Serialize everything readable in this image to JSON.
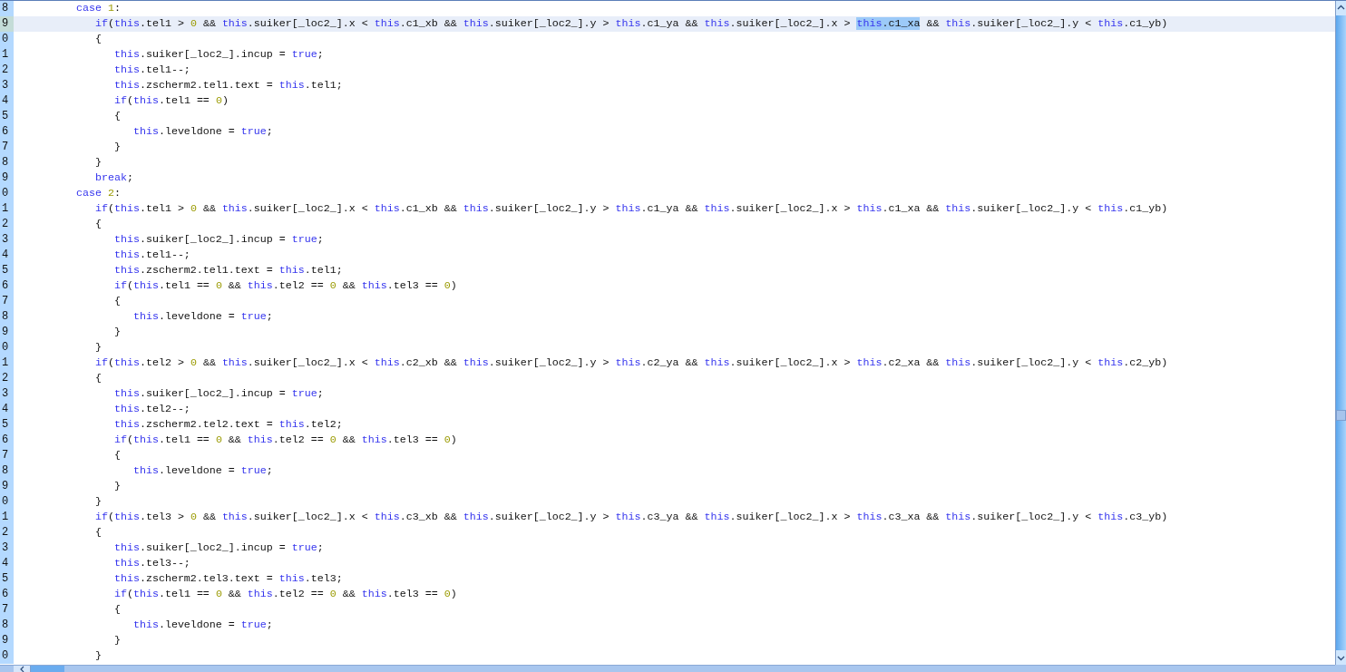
{
  "editor": {
    "lines": [
      {
        "number": "8",
        "current": false,
        "segments": [
          {
            "kind": "keyword",
            "text": "         case "
          },
          {
            "kind": "number",
            "text": "1"
          },
          {
            "kind": "plain",
            "text": ":"
          }
        ]
      },
      {
        "number": "9",
        "current": true,
        "segments": [
          {
            "kind": "keyword",
            "text": "            if"
          },
          {
            "kind": "plain",
            "text": "("
          },
          {
            "kind": "keyword",
            "text": "this"
          },
          {
            "kind": "plain",
            "text": ".tel1 > "
          },
          {
            "kind": "number",
            "text": "0"
          },
          {
            "kind": "plain",
            "text": " && "
          },
          {
            "kind": "keyword",
            "text": "this"
          },
          {
            "kind": "plain",
            "text": ".suiker[_loc2_].x < "
          },
          {
            "kind": "keyword",
            "text": "this"
          },
          {
            "kind": "plain",
            "text": ".c1_xb && "
          },
          {
            "kind": "keyword",
            "text": "this"
          },
          {
            "kind": "plain",
            "text": ".suiker[_loc2_].y > "
          },
          {
            "kind": "keyword",
            "text": "this"
          },
          {
            "kind": "plain",
            "text": ".c1_ya && "
          },
          {
            "kind": "keyword",
            "text": "this"
          },
          {
            "kind": "plain",
            "text": ".suiker[_loc2_].x > "
          },
          {
            "kind": "keyword",
            "text": "this",
            "highlighted": true
          },
          {
            "kind": "plain",
            "text": ".c1_xa",
            "highlighted": true
          },
          {
            "kind": "plain",
            "text": " && "
          },
          {
            "kind": "keyword",
            "text": "this"
          },
          {
            "kind": "plain",
            "text": ".suiker[_loc2_].y < "
          },
          {
            "kind": "keyword",
            "text": "this"
          },
          {
            "kind": "plain",
            "text": ".c1_yb)"
          }
        ]
      },
      {
        "number": "0",
        "current": false,
        "segments": [
          {
            "kind": "plain",
            "text": "            {"
          }
        ]
      },
      {
        "number": "1",
        "current": false,
        "segments": [
          {
            "kind": "keyword",
            "text": "               this"
          },
          {
            "kind": "plain",
            "text": ".suiker[_loc2_].incup = "
          },
          {
            "kind": "keyword",
            "text": "true"
          },
          {
            "kind": "plain",
            "text": ";"
          }
        ]
      },
      {
        "number": "2",
        "current": false,
        "segments": [
          {
            "kind": "keyword",
            "text": "               this"
          },
          {
            "kind": "plain",
            "text": ".tel1--;"
          }
        ]
      },
      {
        "number": "3",
        "current": false,
        "segments": [
          {
            "kind": "keyword",
            "text": "               this"
          },
          {
            "kind": "plain",
            "text": ".zscherm2.tel1.text = "
          },
          {
            "kind": "keyword",
            "text": "this"
          },
          {
            "kind": "plain",
            "text": ".tel1;"
          }
        ]
      },
      {
        "number": "4",
        "current": false,
        "segments": [
          {
            "kind": "keyword",
            "text": "               if"
          },
          {
            "kind": "plain",
            "text": "("
          },
          {
            "kind": "keyword",
            "text": "this"
          },
          {
            "kind": "plain",
            "text": ".tel1 == "
          },
          {
            "kind": "number",
            "text": "0"
          },
          {
            "kind": "plain",
            "text": ")"
          }
        ]
      },
      {
        "number": "5",
        "current": false,
        "segments": [
          {
            "kind": "plain",
            "text": "               {"
          }
        ]
      },
      {
        "number": "6",
        "current": false,
        "segments": [
          {
            "kind": "keyword",
            "text": "                  this"
          },
          {
            "kind": "plain",
            "text": ".leveldone = "
          },
          {
            "kind": "keyword",
            "text": "true"
          },
          {
            "kind": "plain",
            "text": ";"
          }
        ]
      },
      {
        "number": "7",
        "current": false,
        "segments": [
          {
            "kind": "plain",
            "text": "               }"
          }
        ]
      },
      {
        "number": "8",
        "current": false,
        "segments": [
          {
            "kind": "plain",
            "text": "            }"
          }
        ]
      },
      {
        "number": "9",
        "current": false,
        "segments": [
          {
            "kind": "keyword",
            "text": "            break"
          },
          {
            "kind": "plain",
            "text": ";"
          }
        ]
      },
      {
        "number": "0",
        "current": false,
        "segments": [
          {
            "kind": "keyword",
            "text": "         case "
          },
          {
            "kind": "number",
            "text": "2"
          },
          {
            "kind": "plain",
            "text": ":"
          }
        ]
      },
      {
        "number": "1",
        "current": false,
        "segments": [
          {
            "kind": "keyword",
            "text": "            if"
          },
          {
            "kind": "plain",
            "text": "("
          },
          {
            "kind": "keyword",
            "text": "this"
          },
          {
            "kind": "plain",
            "text": ".tel1 > "
          },
          {
            "kind": "number",
            "text": "0"
          },
          {
            "kind": "plain",
            "text": " && "
          },
          {
            "kind": "keyword",
            "text": "this"
          },
          {
            "kind": "plain",
            "text": ".suiker[_loc2_].x < "
          },
          {
            "kind": "keyword",
            "text": "this"
          },
          {
            "kind": "plain",
            "text": ".c1_xb && "
          },
          {
            "kind": "keyword",
            "text": "this"
          },
          {
            "kind": "plain",
            "text": ".suiker[_loc2_].y > "
          },
          {
            "kind": "keyword",
            "text": "this"
          },
          {
            "kind": "plain",
            "text": ".c1_ya && "
          },
          {
            "kind": "keyword",
            "text": "this"
          },
          {
            "kind": "plain",
            "text": ".suiker[_loc2_].x > "
          },
          {
            "kind": "keyword",
            "text": "this"
          },
          {
            "kind": "plain",
            "text": ".c1_xa && "
          },
          {
            "kind": "keyword",
            "text": "this"
          },
          {
            "kind": "plain",
            "text": ".suiker[_loc2_].y < "
          },
          {
            "kind": "keyword",
            "text": "this"
          },
          {
            "kind": "plain",
            "text": ".c1_yb)"
          }
        ]
      },
      {
        "number": "2",
        "current": false,
        "segments": [
          {
            "kind": "plain",
            "text": "            {"
          }
        ]
      },
      {
        "number": "3",
        "current": false,
        "segments": [
          {
            "kind": "keyword",
            "text": "               this"
          },
          {
            "kind": "plain",
            "text": ".suiker[_loc2_].incup = "
          },
          {
            "kind": "keyword",
            "text": "true"
          },
          {
            "kind": "plain",
            "text": ";"
          }
        ]
      },
      {
        "number": "4",
        "current": false,
        "segments": [
          {
            "kind": "keyword",
            "text": "               this"
          },
          {
            "kind": "plain",
            "text": ".tel1--;"
          }
        ]
      },
      {
        "number": "5",
        "current": false,
        "segments": [
          {
            "kind": "keyword",
            "text": "               this"
          },
          {
            "kind": "plain",
            "text": ".zscherm2.tel1.text = "
          },
          {
            "kind": "keyword",
            "text": "this"
          },
          {
            "kind": "plain",
            "text": ".tel1;"
          }
        ]
      },
      {
        "number": "6",
        "current": false,
        "segments": [
          {
            "kind": "keyword",
            "text": "               if"
          },
          {
            "kind": "plain",
            "text": "("
          },
          {
            "kind": "keyword",
            "text": "this"
          },
          {
            "kind": "plain",
            "text": ".tel1 == "
          },
          {
            "kind": "number",
            "text": "0"
          },
          {
            "kind": "plain",
            "text": " && "
          },
          {
            "kind": "keyword",
            "text": "this"
          },
          {
            "kind": "plain",
            "text": ".tel2 == "
          },
          {
            "kind": "number",
            "text": "0"
          },
          {
            "kind": "plain",
            "text": " && "
          },
          {
            "kind": "keyword",
            "text": "this"
          },
          {
            "kind": "plain",
            "text": ".tel3 == "
          },
          {
            "kind": "number",
            "text": "0"
          },
          {
            "kind": "plain",
            "text": ")"
          }
        ]
      },
      {
        "number": "7",
        "current": false,
        "segments": [
          {
            "kind": "plain",
            "text": "               {"
          }
        ]
      },
      {
        "number": "8",
        "current": false,
        "segments": [
          {
            "kind": "keyword",
            "text": "                  this"
          },
          {
            "kind": "plain",
            "text": ".leveldone = "
          },
          {
            "kind": "keyword",
            "text": "true"
          },
          {
            "kind": "plain",
            "text": ";"
          }
        ]
      },
      {
        "number": "9",
        "current": false,
        "segments": [
          {
            "kind": "plain",
            "text": "               }"
          }
        ]
      },
      {
        "number": "0",
        "current": false,
        "segments": [
          {
            "kind": "plain",
            "text": "            }"
          }
        ]
      },
      {
        "number": "1",
        "current": false,
        "segments": [
          {
            "kind": "keyword",
            "text": "            if"
          },
          {
            "kind": "plain",
            "text": "("
          },
          {
            "kind": "keyword",
            "text": "this"
          },
          {
            "kind": "plain",
            "text": ".tel2 > "
          },
          {
            "kind": "number",
            "text": "0"
          },
          {
            "kind": "plain",
            "text": " && "
          },
          {
            "kind": "keyword",
            "text": "this"
          },
          {
            "kind": "plain",
            "text": ".suiker[_loc2_].x < "
          },
          {
            "kind": "keyword",
            "text": "this"
          },
          {
            "kind": "plain",
            "text": ".c2_xb && "
          },
          {
            "kind": "keyword",
            "text": "this"
          },
          {
            "kind": "plain",
            "text": ".suiker[_loc2_].y > "
          },
          {
            "kind": "keyword",
            "text": "this"
          },
          {
            "kind": "plain",
            "text": ".c2_ya && "
          },
          {
            "kind": "keyword",
            "text": "this"
          },
          {
            "kind": "plain",
            "text": ".suiker[_loc2_].x > "
          },
          {
            "kind": "keyword",
            "text": "this"
          },
          {
            "kind": "plain",
            "text": ".c2_xa && "
          },
          {
            "kind": "keyword",
            "text": "this"
          },
          {
            "kind": "plain",
            "text": ".suiker[_loc2_].y < "
          },
          {
            "kind": "keyword",
            "text": "this"
          },
          {
            "kind": "plain",
            "text": ".c2_yb)"
          }
        ]
      },
      {
        "number": "2",
        "current": false,
        "segments": [
          {
            "kind": "plain",
            "text": "            {"
          }
        ]
      },
      {
        "number": "3",
        "current": false,
        "segments": [
          {
            "kind": "keyword",
            "text": "               this"
          },
          {
            "kind": "plain",
            "text": ".suiker[_loc2_].incup = "
          },
          {
            "kind": "keyword",
            "text": "true"
          },
          {
            "kind": "plain",
            "text": ";"
          }
        ]
      },
      {
        "number": "4",
        "current": false,
        "segments": [
          {
            "kind": "keyword",
            "text": "               this"
          },
          {
            "kind": "plain",
            "text": ".tel2--;"
          }
        ]
      },
      {
        "number": "5",
        "current": false,
        "segments": [
          {
            "kind": "keyword",
            "text": "               this"
          },
          {
            "kind": "plain",
            "text": ".zscherm2.tel2.text = "
          },
          {
            "kind": "keyword",
            "text": "this"
          },
          {
            "kind": "plain",
            "text": ".tel2;"
          }
        ]
      },
      {
        "number": "6",
        "current": false,
        "segments": [
          {
            "kind": "keyword",
            "text": "               if"
          },
          {
            "kind": "plain",
            "text": "("
          },
          {
            "kind": "keyword",
            "text": "this"
          },
          {
            "kind": "plain",
            "text": ".tel1 == "
          },
          {
            "kind": "number",
            "text": "0"
          },
          {
            "kind": "plain",
            "text": " && "
          },
          {
            "kind": "keyword",
            "text": "this"
          },
          {
            "kind": "plain",
            "text": ".tel2 == "
          },
          {
            "kind": "number",
            "text": "0"
          },
          {
            "kind": "plain",
            "text": " && "
          },
          {
            "kind": "keyword",
            "text": "this"
          },
          {
            "kind": "plain",
            "text": ".tel3 == "
          },
          {
            "kind": "number",
            "text": "0"
          },
          {
            "kind": "plain",
            "text": ")"
          }
        ]
      },
      {
        "number": "7",
        "current": false,
        "segments": [
          {
            "kind": "plain",
            "text": "               {"
          }
        ]
      },
      {
        "number": "8",
        "current": false,
        "segments": [
          {
            "kind": "keyword",
            "text": "                  this"
          },
          {
            "kind": "plain",
            "text": ".leveldone = "
          },
          {
            "kind": "keyword",
            "text": "true"
          },
          {
            "kind": "plain",
            "text": ";"
          }
        ]
      },
      {
        "number": "9",
        "current": false,
        "segments": [
          {
            "kind": "plain",
            "text": "               }"
          }
        ]
      },
      {
        "number": "0",
        "current": false,
        "segments": [
          {
            "kind": "plain",
            "text": "            }"
          }
        ]
      },
      {
        "number": "1",
        "current": false,
        "segments": [
          {
            "kind": "keyword",
            "text": "            if"
          },
          {
            "kind": "plain",
            "text": "("
          },
          {
            "kind": "keyword",
            "text": "this"
          },
          {
            "kind": "plain",
            "text": ".tel3 > "
          },
          {
            "kind": "number",
            "text": "0"
          },
          {
            "kind": "plain",
            "text": " && "
          },
          {
            "kind": "keyword",
            "text": "this"
          },
          {
            "kind": "plain",
            "text": ".suiker[_loc2_].x < "
          },
          {
            "kind": "keyword",
            "text": "this"
          },
          {
            "kind": "plain",
            "text": ".c3_xb && "
          },
          {
            "kind": "keyword",
            "text": "this"
          },
          {
            "kind": "plain",
            "text": ".suiker[_loc2_].y > "
          },
          {
            "kind": "keyword",
            "text": "this"
          },
          {
            "kind": "plain",
            "text": ".c3_ya && "
          },
          {
            "kind": "keyword",
            "text": "this"
          },
          {
            "kind": "plain",
            "text": ".suiker[_loc2_].x > "
          },
          {
            "kind": "keyword",
            "text": "this"
          },
          {
            "kind": "plain",
            "text": ".c3_xa && "
          },
          {
            "kind": "keyword",
            "text": "this"
          },
          {
            "kind": "plain",
            "text": ".suiker[_loc2_].y < "
          },
          {
            "kind": "keyword",
            "text": "this"
          },
          {
            "kind": "plain",
            "text": ".c3_yb)"
          }
        ]
      },
      {
        "number": "2",
        "current": false,
        "segments": [
          {
            "kind": "plain",
            "text": "            {"
          }
        ]
      },
      {
        "number": "3",
        "current": false,
        "segments": [
          {
            "kind": "keyword",
            "text": "               this"
          },
          {
            "kind": "plain",
            "text": ".suiker[_loc2_].incup = "
          },
          {
            "kind": "keyword",
            "text": "true"
          },
          {
            "kind": "plain",
            "text": ";"
          }
        ]
      },
      {
        "number": "4",
        "current": false,
        "segments": [
          {
            "kind": "keyword",
            "text": "               this"
          },
          {
            "kind": "plain",
            "text": ".tel3--;"
          }
        ]
      },
      {
        "number": "5",
        "current": false,
        "segments": [
          {
            "kind": "keyword",
            "text": "               this"
          },
          {
            "kind": "plain",
            "text": ".zscherm2.tel3.text = "
          },
          {
            "kind": "keyword",
            "text": "this"
          },
          {
            "kind": "plain",
            "text": ".tel3;"
          }
        ]
      },
      {
        "number": "6",
        "current": false,
        "segments": [
          {
            "kind": "keyword",
            "text": "               if"
          },
          {
            "kind": "plain",
            "text": "("
          },
          {
            "kind": "keyword",
            "text": "this"
          },
          {
            "kind": "plain",
            "text": ".tel1 == "
          },
          {
            "kind": "number",
            "text": "0"
          },
          {
            "kind": "plain",
            "text": " && "
          },
          {
            "kind": "keyword",
            "text": "this"
          },
          {
            "kind": "plain",
            "text": ".tel2 == "
          },
          {
            "kind": "number",
            "text": "0"
          },
          {
            "kind": "plain",
            "text": " && "
          },
          {
            "kind": "keyword",
            "text": "this"
          },
          {
            "kind": "plain",
            "text": ".tel3 == "
          },
          {
            "kind": "number",
            "text": "0"
          },
          {
            "kind": "plain",
            "text": ")"
          }
        ]
      },
      {
        "number": "7",
        "current": false,
        "segments": [
          {
            "kind": "plain",
            "text": "               {"
          }
        ]
      },
      {
        "number": "8",
        "current": false,
        "segments": [
          {
            "kind": "keyword",
            "text": "                  this"
          },
          {
            "kind": "plain",
            "text": ".leveldone = "
          },
          {
            "kind": "keyword",
            "text": "true"
          },
          {
            "kind": "plain",
            "text": ";"
          }
        ]
      },
      {
        "number": "9",
        "current": false,
        "segments": [
          {
            "kind": "plain",
            "text": "               }"
          }
        ]
      },
      {
        "number": "0",
        "current": false,
        "segments": [
          {
            "kind": "plain",
            "text": "            }"
          }
        ]
      }
    ]
  }
}
